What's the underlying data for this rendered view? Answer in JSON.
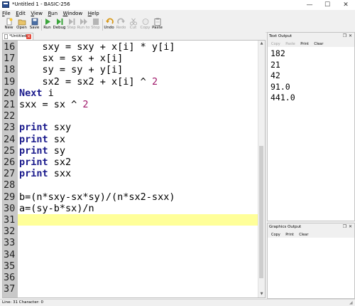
{
  "window": {
    "title": "*Untitled 1 - BASIC-256",
    "minimize_glyph": "—",
    "maximize_glyph": "☐",
    "close_glyph": "✕"
  },
  "menu": [
    {
      "underline": "F",
      "rest": "ile"
    },
    {
      "underline": "E",
      "rest": "dit"
    },
    {
      "underline": "V",
      "rest": "iew"
    },
    {
      "underline": "R",
      "rest": "un"
    },
    {
      "underline": "W",
      "rest": "indow"
    },
    {
      "underline": "H",
      "rest": "elp"
    }
  ],
  "toolbar": {
    "new": "New",
    "open": "Open",
    "save": "Save",
    "run": "Run",
    "debug": "Debug",
    "step": "Step",
    "run_to": "Run to",
    "stop": "Stop",
    "undo": "Undo",
    "redo": "Redo",
    "cut": "Cut",
    "copy": "Copy",
    "paste": "Paste"
  },
  "tab": {
    "label": "*Untitled 1",
    "close_glyph": "×"
  },
  "editor": {
    "lines": [
      {
        "num": "16",
        "tokens": [
          {
            "t": "    sxy = sxy + x[i] * y[i]",
            "c": ""
          }
        ]
      },
      {
        "num": "17",
        "tokens": [
          {
            "t": "    sx = sx + x[i]",
            "c": ""
          }
        ]
      },
      {
        "num": "18",
        "tokens": [
          {
            "t": "    sy = sy + y[i]",
            "c": ""
          }
        ]
      },
      {
        "num": "19",
        "tokens": [
          {
            "t": "    sx2 = sx2 + x[i] ^ ",
            "c": ""
          },
          {
            "t": "2",
            "c": "num"
          }
        ]
      },
      {
        "num": "20",
        "tokens": [
          {
            "t": "Next",
            "c": "kw"
          },
          {
            "t": " i",
            "c": ""
          }
        ]
      },
      {
        "num": "21",
        "tokens": [
          {
            "t": "sxx = sx ^ ",
            "c": ""
          },
          {
            "t": "2",
            "c": "num"
          }
        ]
      },
      {
        "num": "22",
        "tokens": []
      },
      {
        "num": "23",
        "tokens": [
          {
            "t": "print",
            "c": "kw"
          },
          {
            "t": " sxy",
            "c": ""
          }
        ]
      },
      {
        "num": "24",
        "tokens": [
          {
            "t": "print",
            "c": "kw"
          },
          {
            "t": " sx",
            "c": ""
          }
        ]
      },
      {
        "num": "25",
        "tokens": [
          {
            "t": "print",
            "c": "kw"
          },
          {
            "t": " sy",
            "c": ""
          }
        ]
      },
      {
        "num": "26",
        "tokens": [
          {
            "t": "print",
            "c": "kw"
          },
          {
            "t": " sx2",
            "c": ""
          }
        ]
      },
      {
        "num": "27",
        "tokens": [
          {
            "t": "print",
            "c": "kw"
          },
          {
            "t": " sxx",
            "c": ""
          }
        ]
      },
      {
        "num": "28",
        "tokens": []
      },
      {
        "num": "29",
        "tokens": [
          {
            "t": "b=(n*sxy-sx*sy)/(n*sx2-sxx)",
            "c": ""
          }
        ]
      },
      {
        "num": "30",
        "tokens": [
          {
            "t": "a=(sy-b*sx)/n",
            "c": ""
          }
        ]
      },
      {
        "num": "31",
        "tokens": [],
        "current": true
      },
      {
        "num": "32",
        "tokens": []
      },
      {
        "num": "33",
        "tokens": []
      },
      {
        "num": "34",
        "tokens": []
      },
      {
        "num": "35",
        "tokens": []
      },
      {
        "num": "36",
        "tokens": []
      },
      {
        "num": "37",
        "tokens": []
      }
    ]
  },
  "text_output": {
    "title": "Text Output",
    "tools": [
      "Copy",
      "Paste",
      "Print",
      "Clear"
    ],
    "tools_disabled": [
      true,
      true,
      false,
      false
    ],
    "lines": [
      "182",
      "21",
      "42",
      "91.0",
      "441.0"
    ]
  },
  "graphics_output": {
    "title": "Graphics Output",
    "tools": [
      "Copy",
      "Print",
      "Clear"
    ]
  },
  "status": {
    "text": "Line: 31 Character: 0"
  },
  "colors": {
    "keyword": "#1a1a8c",
    "number": "#a0186a",
    "current_line": "#ffff99",
    "gutter": "#c8c8c8"
  }
}
